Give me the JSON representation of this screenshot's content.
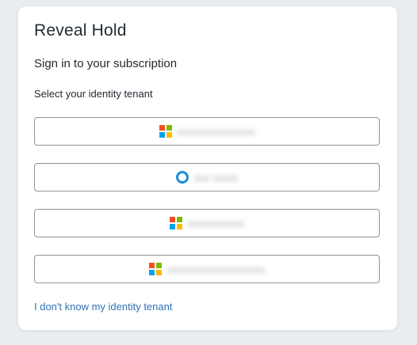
{
  "app": {
    "title": "Reveal Hold",
    "subtitle": "Sign in to your subscription",
    "select_label": "Select your identity tenant",
    "help_link": "I don't know my identity tenant"
  },
  "colors": {
    "background": "#e9ecf0",
    "card": "#ffffff",
    "link": "#2f73b7",
    "border": "#8f959c",
    "ms_red": "#f25022",
    "ms_green": "#7fba00",
    "ms_blue": "#00a4ef",
    "ms_yellow": "#ffb900",
    "ring_blue": "#1b8ed8"
  },
  "tenants": [
    {
      "icon": "microsoft-logo-icon",
      "label": "Tenant name (blurred)"
    },
    {
      "icon": "identity-provider-ring-icon",
      "label": "Tenant name (blurred)"
    },
    {
      "icon": "microsoft-logo-icon",
      "label": "Tenant name (blurred)"
    },
    {
      "icon": "microsoft-logo-icon",
      "label": "Tenant name (blurred)"
    }
  ]
}
